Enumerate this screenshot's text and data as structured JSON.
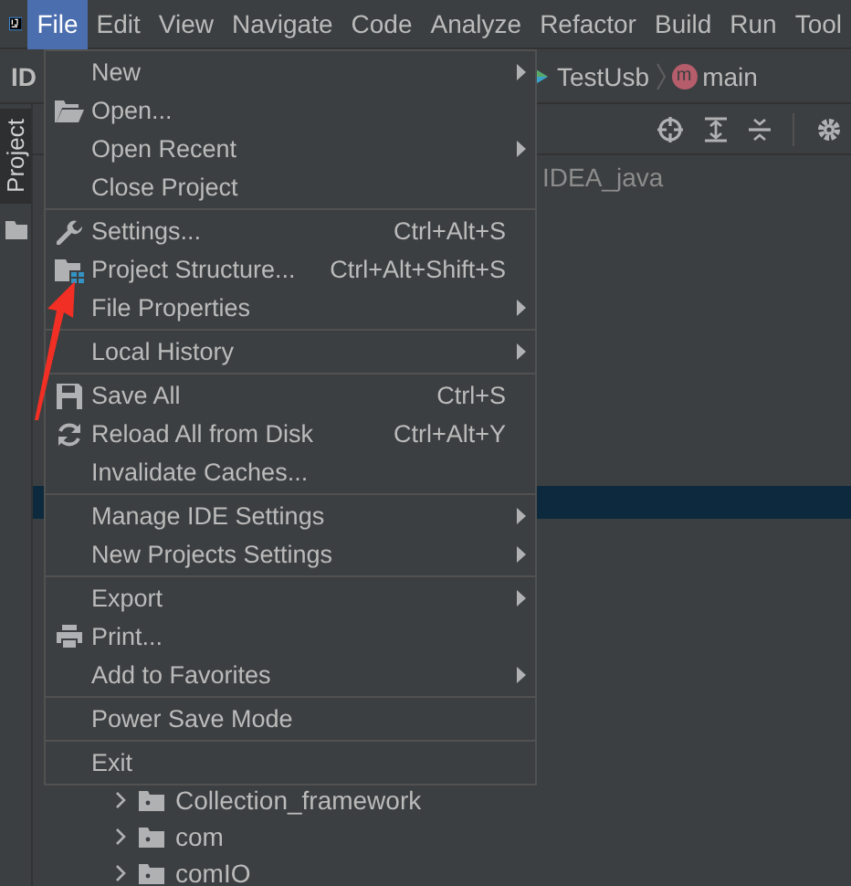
{
  "menubar": {
    "items": [
      {
        "label": "File",
        "selected": true
      },
      {
        "label": "Edit",
        "selected": false
      },
      {
        "label": "View",
        "selected": false
      },
      {
        "label": "Navigate",
        "selected": false
      },
      {
        "label": "Code",
        "selected": false
      },
      {
        "label": "Analyze",
        "selected": false
      },
      {
        "label": "Refactor",
        "selected": false
      },
      {
        "label": "Build",
        "selected": false
      },
      {
        "label": "Run",
        "selected": false
      },
      {
        "label": "Tool",
        "selected": false
      }
    ]
  },
  "navbar": {
    "project": "ID",
    "crumbs": [
      {
        "label": "TestUsb"
      },
      {
        "label": "main",
        "badge": "m"
      }
    ]
  },
  "tool_strip": {
    "label": "Project"
  },
  "tree": {
    "root": "IDEA_java",
    "rows": [
      {
        "label": "Collection_framework",
        "expanded": false
      },
      {
        "label": "com",
        "expanded": false
      },
      {
        "label": "comIO",
        "expanded": false
      }
    ]
  },
  "file_menu": {
    "items": [
      {
        "kind": "item",
        "label": "New",
        "submenu": true
      },
      {
        "kind": "item",
        "label": "Open..."
      },
      {
        "kind": "item",
        "label": "Open Recent",
        "submenu": true
      },
      {
        "kind": "item",
        "label": "Close Project"
      },
      {
        "kind": "separator"
      },
      {
        "kind": "item",
        "label": "Settings...",
        "shortcut": "Ctrl+Alt+S"
      },
      {
        "kind": "item",
        "label": "Project Structure...",
        "shortcut": "Ctrl+Alt+Shift+S"
      },
      {
        "kind": "item",
        "label": "File Properties",
        "submenu": true
      },
      {
        "kind": "separator"
      },
      {
        "kind": "item",
        "label": "Local History",
        "submenu": true
      },
      {
        "kind": "separator"
      },
      {
        "kind": "item",
        "label": "Save All",
        "shortcut": "Ctrl+S"
      },
      {
        "kind": "item",
        "label": "Reload All from Disk",
        "shortcut": "Ctrl+Alt+Y"
      },
      {
        "kind": "item",
        "label": "Invalidate Caches..."
      },
      {
        "kind": "separator"
      },
      {
        "kind": "item",
        "label": "Manage IDE Settings",
        "submenu": true
      },
      {
        "kind": "item",
        "label": "New Projects Settings",
        "submenu": true
      },
      {
        "kind": "separator"
      },
      {
        "kind": "item",
        "label": "Export",
        "submenu": true
      },
      {
        "kind": "item",
        "label": "Print..."
      },
      {
        "kind": "item",
        "label": "Add to Favorites",
        "submenu": true
      },
      {
        "kind": "separator"
      },
      {
        "kind": "item",
        "label": "Power Save Mode"
      },
      {
        "kind": "separator"
      },
      {
        "kind": "item",
        "label": "Exit"
      }
    ]
  }
}
